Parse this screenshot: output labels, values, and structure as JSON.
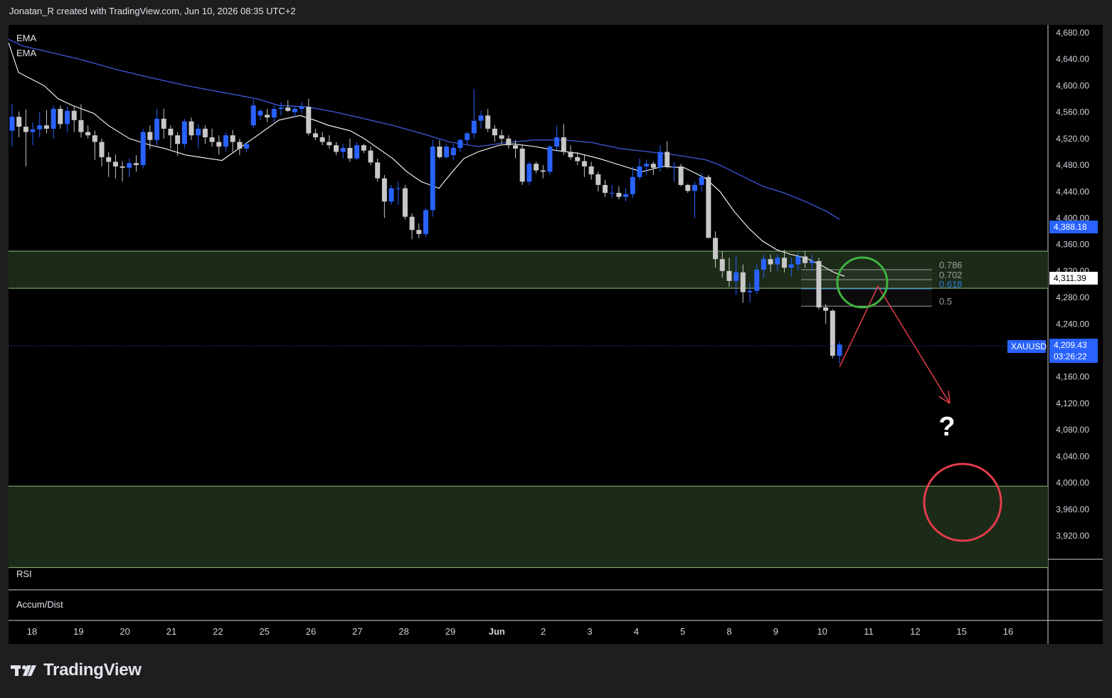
{
  "header": {
    "attribution": "Jonatan_R created with TradingView.com, Jun 10, 2026 08:35 UTC+2"
  },
  "indicators": {
    "ema1": "EMA",
    "ema2": "EMA",
    "rsi": "RSI",
    "accum": "Accum/Dist"
  },
  "symbol": "XAUUSD",
  "price_tags": {
    "ema_slow": "4,388.18",
    "ema_fast": "4,311.39",
    "last": "4,209.43",
    "countdown": "03:26:22"
  },
  "annotation": {
    "question": "?"
  },
  "footer": {
    "brand": "TradingView"
  },
  "colors": {
    "up": "#2962ff",
    "down": "#c8c8c8",
    "ema_fast": "#ffffff",
    "ema_slow": "#3b5bdb",
    "zone_fill": "#1c2a18",
    "zone_line": "#8fbf7a",
    "green_circle": "#3fb43f",
    "red_circle": "#e23c4a",
    "projection": "#e23c4a"
  },
  "chart_data": {
    "type": "candlestick",
    "y_axis": {
      "range": [
        3880,
        4700
      ],
      "ticks": [
        "4,680.00",
        "4,640.00",
        "4,600.00",
        "4,560.00",
        "4,520.00",
        "4,480.00",
        "4,440.00",
        "4,400.00",
        "4,360.00",
        "4,320.00",
        "4,280.00",
        "4,240.00",
        "4,200.00",
        "4,160.00",
        "4,120.00",
        "4,080.00",
        "4,040.00",
        "4,000.00",
        "3,960.00",
        "3,920.00"
      ]
    },
    "x_axis": {
      "labels": [
        "18",
        "19",
        "20",
        "21",
        "22",
        "25",
        "26",
        "27",
        "28",
        "29",
        "Jun",
        "2",
        "3",
        "4",
        "5",
        "8",
        "9",
        "10",
        "11",
        "12",
        "15",
        "16"
      ]
    },
    "zones": [
      {
        "from": 4294,
        "to": 4350
      },
      {
        "from": 3872,
        "to": 3995
      }
    ],
    "fibonacci": {
      "levels": [
        {
          "label": "0.786",
          "value": 4322,
          "color": "#9e9e9e"
        },
        {
          "label": "0.702",
          "value": 4307,
          "color": "#9e9e9e"
        },
        {
          "label": "0.618",
          "value": 4293,
          "color": "#2b7fd9"
        },
        {
          "label": "0.5",
          "value": 4267,
          "color": "#9e9e9e"
        }
      ]
    },
    "candles": [
      [
        4532,
        4572,
        4508,
        4553
      ],
      [
        4553,
        4561,
        4522,
        4538
      ],
      [
        4538,
        4564,
        4478,
        4530
      ],
      [
        4530,
        4545,
        4510,
        4534
      ],
      [
        4534,
        4560,
        4522,
        4540
      ],
      [
        4540,
        4563,
        4528,
        4535
      ],
      [
        4535,
        4570,
        4520,
        4565
      ],
      [
        4565,
        4570,
        4535,
        4542
      ],
      [
        4542,
        4568,
        4530,
        4562
      ],
      [
        4562,
        4570,
        4530,
        4548
      ],
      [
        4548,
        4572,
        4522,
        4530
      ],
      [
        4530,
        4540,
        4520,
        4525
      ],
      [
        4525,
        4532,
        4488,
        4515
      ],
      [
        4515,
        4520,
        4478,
        4492
      ],
      [
        4492,
        4500,
        4462,
        4485
      ],
      [
        4485,
        4496,
        4460,
        4478
      ],
      [
        4478,
        4486,
        4455,
        4476
      ],
      [
        4476,
        4490,
        4462,
        4483
      ],
      [
        4483,
        4495,
        4470,
        4480
      ],
      [
        4480,
        4535,
        4475,
        4530
      ],
      [
        4530,
        4540,
        4505,
        4518
      ],
      [
        4518,
        4565,
        4510,
        4550
      ],
      [
        4550,
        4565,
        4520,
        4535
      ],
      [
        4535,
        4540,
        4505,
        4525
      ],
      [
        4525,
        4530,
        4494,
        4512
      ],
      [
        4512,
        4550,
        4505,
        4546
      ],
      [
        4546,
        4552,
        4518,
        4525
      ],
      [
        4525,
        4542,
        4505,
        4535
      ],
      [
        4535,
        4540,
        4512,
        4522
      ],
      [
        4522,
        4535,
        4508,
        4515
      ],
      [
        4515,
        4525,
        4496,
        4508
      ],
      [
        4508,
        4530,
        4500,
        4525
      ],
      [
        4525,
        4533,
        4500,
        4515
      ],
      [
        4515,
        4520,
        4495,
        4505
      ],
      [
        4505,
        4515,
        4500,
        4512
      ],
      [
        4540,
        4580,
        4536,
        4570
      ],
      [
        4555,
        4565,
        4548,
        4562
      ],
      [
        4556,
        4565,
        4545,
        4552
      ],
      [
        4552,
        4570,
        4545,
        4565
      ],
      [
        4565,
        4575,
        4555,
        4567
      ],
      [
        4567,
        4578,
        4560,
        4562
      ],
      [
        4560,
        4568,
        4552,
        4565
      ],
      [
        4565,
        4575,
        4558,
        4568
      ],
      [
        4568,
        4580,
        4525,
        4528
      ],
      [
        4528,
        4535,
        4518,
        4522
      ],
      [
        4522,
        4530,
        4510,
        4515
      ],
      [
        4515,
        4525,
        4505,
        4510
      ],
      [
        4510,
        4515,
        4495,
        4500
      ],
      [
        4500,
        4512,
        4490,
        4506
      ],
      [
        4506,
        4520,
        4485,
        4490
      ],
      [
        4490,
        4515,
        4488,
        4510
      ],
      [
        4510,
        4512,
        4498,
        4502
      ],
      [
        4502,
        4508,
        4480,
        4484
      ],
      [
        4484,
        4490,
        4455,
        4460
      ],
      [
        4460,
        4465,
        4400,
        4425
      ],
      [
        4425,
        4450,
        4420,
        4445
      ],
      [
        4445,
        4455,
        4420,
        4445
      ],
      [
        4445,
        4450,
        4398,
        4402
      ],
      [
        4402,
        4407,
        4368,
        4382
      ],
      [
        4382,
        4392,
        4370,
        4376
      ],
      [
        4376,
        4415,
        4372,
        4412
      ],
      [
        4412,
        4518,
        4402,
        4508
      ],
      [
        4508,
        4518,
        4490,
        4492
      ],
      [
        4492,
        4512,
        4490,
        4508
      ],
      [
        4495,
        4512,
        4488,
        4506
      ],
      [
        4506,
        4520,
        4500,
        4518
      ],
      [
        4518,
        4530,
        4512,
        4528
      ],
      [
        4528,
        4595,
        4520,
        4547
      ],
      [
        4547,
        4562,
        4535,
        4555
      ],
      [
        4555,
        4565,
        4530,
        4535
      ],
      [
        4535,
        4540,
        4515,
        4525
      ],
      [
        4525,
        4533,
        4512,
        4520
      ],
      [
        4520,
        4525,
        4505,
        4510
      ],
      [
        4510,
        4518,
        4490,
        4505
      ],
      [
        4505,
        4510,
        4450,
        4455
      ],
      [
        4455,
        4485,
        4450,
        4482
      ],
      [
        4482,
        4485,
        4468,
        4472
      ],
      [
        4472,
        4480,
        4460,
        4470
      ],
      [
        4470,
        4510,
        4465,
        4508
      ],
      [
        4508,
        4540,
        4500,
        4522
      ],
      [
        4522,
        4542,
        4495,
        4500
      ],
      [
        4500,
        4510,
        4488,
        4492
      ],
      [
        4492,
        4500,
        4480,
        4486
      ],
      [
        4486,
        4495,
        4462,
        4478
      ],
      [
        4478,
        4485,
        4458,
        4466
      ],
      [
        4466,
        4470,
        4440,
        4450
      ],
      [
        4450,
        4458,
        4432,
        4438
      ],
      [
        4438,
        4450,
        4430,
        4438
      ],
      [
        4438,
        4448,
        4428,
        4432
      ],
      [
        4432,
        4445,
        4425,
        4436
      ],
      [
        4436,
        4478,
        4430,
        4462
      ],
      [
        4462,
        4490,
        4458,
        4478
      ],
      [
        4478,
        4488,
        4465,
        4482
      ],
      [
        4482,
        4485,
        4465,
        4476
      ],
      [
        4476,
        4510,
        4470,
        4500
      ],
      [
        4500,
        4516,
        4475,
        4478
      ],
      [
        4478,
        4485,
        4455,
        4478
      ],
      [
        4478,
        4482,
        4448,
        4450
      ],
      [
        4450,
        4452,
        4438,
        4441
      ],
      [
        4441,
        4455,
        4400,
        4450
      ],
      [
        4450,
        4468,
        4440,
        4462
      ],
      [
        4462,
        4465,
        4370,
        4370
      ],
      [
        4370,
        4380,
        4325,
        4338
      ],
      [
        4338,
        4350,
        4310,
        4320
      ],
      [
        4320,
        4340,
        4296,
        4305
      ],
      [
        4305,
        4342,
        4284,
        4318
      ],
      [
        4318,
        4330,
        4272,
        4288
      ],
      [
        4288,
        4302,
        4272,
        4290
      ],
      [
        4290,
        4330,
        4285,
        4322
      ],
      [
        4322,
        4345,
        4310,
        4338
      ],
      [
        4338,
        4345,
        4318,
        4330
      ],
      [
        4330,
        4345,
        4320,
        4340
      ],
      [
        4340,
        4352,
        4318,
        4325
      ],
      [
        4325,
        4340,
        4312,
        4330
      ],
      [
        4330,
        4348,
        4320,
        4342
      ],
      [
        4342,
        4350,
        4325,
        4332
      ],
      [
        4332,
        4345,
        4320,
        4335
      ],
      [
        4335,
        4340,
        4262,
        4265
      ],
      [
        4265,
        4270,
        4240,
        4260
      ],
      [
        4260,
        4262,
        4188,
        4192
      ],
      [
        4192,
        4214,
        4180,
        4209
      ]
    ],
    "ema_fast": [
      [
        0,
        4665
      ],
      [
        14,
        4620
      ],
      [
        50,
        4600
      ],
      [
        70,
        4580
      ],
      [
        90,
        4570
      ],
      [
        120,
        4558
      ],
      [
        140,
        4540
      ],
      [
        170,
        4520
      ],
      [
        200,
        4510
      ],
      [
        220,
        4505
      ],
      [
        250,
        4495
      ],
      [
        300,
        4487
      ],
      [
        350,
        4525
      ],
      [
        380,
        4548
      ],
      [
        410,
        4555
      ],
      [
        430,
        4548
      ],
      [
        450,
        4540
      ],
      [
        480,
        4532
      ],
      [
        500,
        4520
      ],
      [
        520,
        4505
      ],
      [
        540,
        4490
      ],
      [
        560,
        4470
      ],
      [
        580,
        4455
      ],
      [
        605,
        4445
      ],
      [
        620,
        4465
      ],
      [
        640,
        4490
      ],
      [
        660,
        4500
      ],
      [
        690,
        4510
      ],
      [
        710,
        4512
      ],
      [
        740,
        4508
      ],
      [
        770,
        4502
      ],
      [
        800,
        4498
      ],
      [
        830,
        4490
      ],
      [
        860,
        4480
      ],
      [
        890,
        4470
      ],
      [
        920,
        4478
      ],
      [
        950,
        4476
      ],
      [
        980,
        4460
      ],
      [
        1000,
        4440
      ],
      [
        1020,
        4410
      ],
      [
        1040,
        4385
      ],
      [
        1060,
        4365
      ],
      [
        1080,
        4352
      ],
      [
        1100,
        4345
      ],
      [
        1120,
        4340
      ],
      [
        1140,
        4330
      ],
      [
        1160,
        4318
      ],
      [
        1175,
        4312
      ]
    ],
    "ema_slow": [
      [
        0,
        4670
      ],
      [
        20,
        4660
      ],
      [
        60,
        4650
      ],
      [
        100,
        4640
      ],
      [
        150,
        4625
      ],
      [
        200,
        4612
      ],
      [
        250,
        4600
      ],
      [
        300,
        4590
      ],
      [
        350,
        4580
      ],
      [
        380,
        4570
      ],
      [
        420,
        4568
      ],
      [
        460,
        4560
      ],
      [
        500,
        4550
      ],
      [
        540,
        4540
      ],
      [
        580,
        4528
      ],
      [
        620,
        4515
      ],
      [
        660,
        4508
      ],
      [
        700,
        4514
      ],
      [
        740,
        4518
      ],
      [
        780,
        4518
      ],
      [
        820,
        4514
      ],
      [
        860,
        4505
      ],
      [
        900,
        4500
      ],
      [
        940,
        4495
      ],
      [
        980,
        4488
      ],
      [
        1000,
        4480
      ],
      [
        1030,
        4464
      ],
      [
        1060,
        4448
      ],
      [
        1090,
        4438
      ],
      [
        1120,
        4425
      ],
      [
        1150,
        4410
      ],
      [
        1168,
        4398
      ]
    ],
    "projection": [
      [
        1168,
        4175
      ],
      [
        1222,
        4297
      ],
      [
        1323,
        4120
      ]
    ]
  }
}
